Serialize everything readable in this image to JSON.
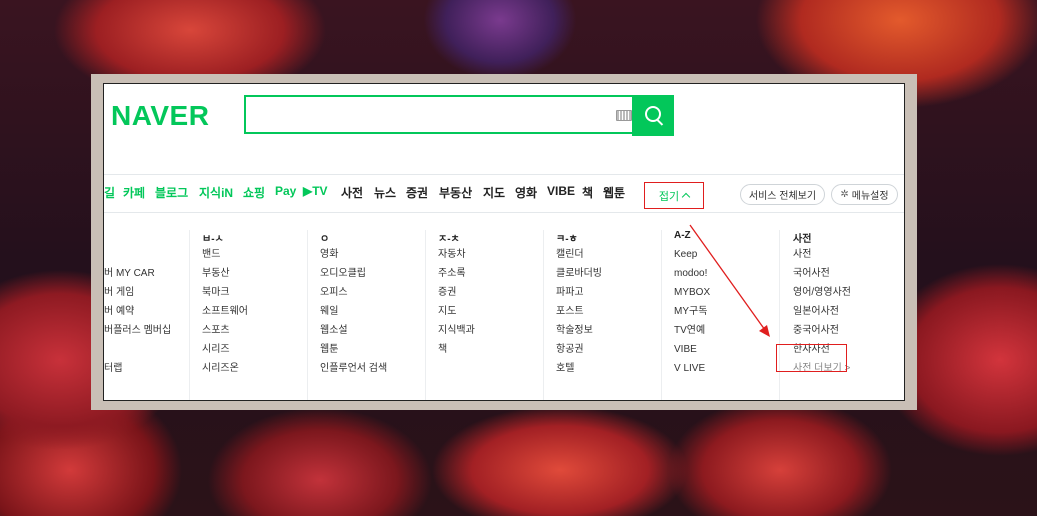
{
  "logo": "NAVER",
  "search": {
    "value": "",
    "placeholder": ""
  },
  "nav_items": [
    {
      "label": "길",
      "color": "green"
    },
    {
      "label": "카페",
      "color": "green"
    },
    {
      "label": "블로그",
      "color": "green"
    },
    {
      "label": "지식iN",
      "color": "green"
    },
    {
      "label": "쇼핑",
      "color": "green"
    },
    {
      "label": "Pay",
      "color": "green"
    },
    {
      "label": "▶TV",
      "color": "green"
    },
    {
      "label": "사전",
      "color": "dark"
    },
    {
      "label": "뉴스",
      "color": "dark"
    },
    {
      "label": "증권",
      "color": "dark"
    },
    {
      "label": "부동산",
      "color": "dark"
    },
    {
      "label": "지도",
      "color": "dark"
    },
    {
      "label": "영화",
      "color": "dark"
    },
    {
      "label": "VIBE",
      "color": "dark"
    },
    {
      "label": "책",
      "color": "dark"
    },
    {
      "label": "웹툰",
      "color": "dark"
    }
  ],
  "fold_label": "접기",
  "all_services_label": "서비스 전체보기",
  "menu_settings_label": "메뉴설정",
  "columns": [
    {
      "head": "",
      "items": [
        "",
        "버 MY CAR",
        "버 게임",
        "버 예약",
        "버플러스 멤버십",
        "",
        "터랩"
      ]
    },
    {
      "head": "ㅂ-ㅅ",
      "items": [
        "밴드",
        "부동산",
        "북마크",
        "소프트웨어",
        "스포츠",
        "시리즈",
        "시리즈온"
      ]
    },
    {
      "head": "ㅇ",
      "items": [
        "영화",
        "오디오클립",
        "오피스",
        "웨일",
        "웹소설",
        "웹툰",
        "인플루언서 검색"
      ]
    },
    {
      "head": "ㅈ-ㅊ",
      "items": [
        "자동차",
        "주소록",
        "증권",
        "지도",
        "지식백과",
        "책"
      ]
    },
    {
      "head": "ㅋ-ㅎ",
      "items": [
        "캘린더",
        "클로바더빙",
        "파파고",
        "포스트",
        "학술정보",
        "항공권",
        "호텔"
      ]
    },
    {
      "head": "A-Z",
      "items": [
        "Keep",
        "modoo!",
        "MYBOX",
        "MY구독",
        "TV연예",
        "VIBE",
        "V LIVE"
      ]
    },
    {
      "head": "사전",
      "items": [
        "사전",
        "국어사전",
        "영어/영영사전",
        "일본어사전",
        "중국어사전",
        "한자사전",
        "사전 더보기 >"
      ]
    }
  ],
  "colors": {
    "brand_green": "#03c75a",
    "highlight_red": "#e01e1e"
  }
}
